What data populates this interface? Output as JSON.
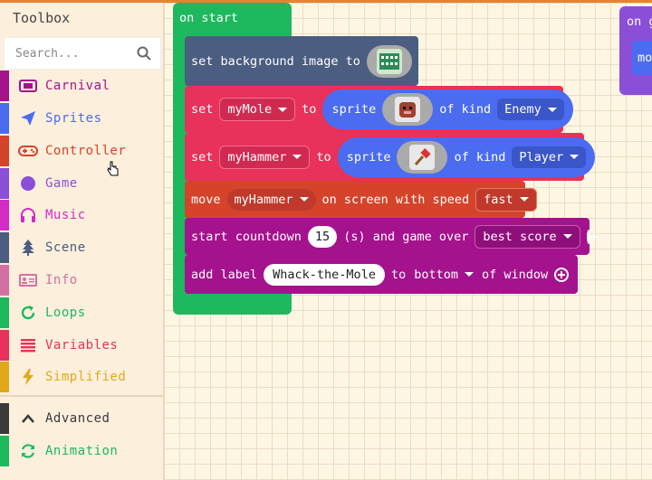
{
  "toolbox": {
    "title": "Toolbox",
    "search_placeholder": "Search...",
    "categories": [
      {
        "label": "Carnival",
        "color": "#a5128d",
        "text_color": "#a5128d",
        "icon": "ticket-icon"
      },
      {
        "label": "Sprites",
        "color": "#4b6cf0",
        "text_color": "#4b6cf0",
        "icon": "paper-plane-icon"
      },
      {
        "label": "Controller",
        "color": "#d5432b",
        "text_color": "#d5432b",
        "icon": "gamepad-icon"
      },
      {
        "label": "Game",
        "color": "#8a4fd6",
        "text_color": "#8a4fd6",
        "icon": "circle-icon"
      },
      {
        "label": "Music",
        "color": "#d22cc5",
        "text_color": "#d22cc5",
        "icon": "headphones-icon"
      },
      {
        "label": "Scene",
        "color": "#4b5d80",
        "text_color": "#4b5d80",
        "icon": "tree-icon"
      },
      {
        "label": "Info",
        "color": "#d36fa3",
        "text_color": "#d36fa3",
        "icon": "id-card-icon"
      },
      {
        "label": "Loops",
        "color": "#1eb85f",
        "text_color": "#1eb85f",
        "icon": "loop-icon"
      },
      {
        "label": "Variables",
        "color": "#e8315b",
        "text_color": "#e8315b",
        "icon": "list-icon"
      },
      {
        "label": "Simplified",
        "color": "#e0a91b",
        "text_color": "#e0a91b",
        "icon": "lightning-icon"
      },
      {
        "label": "Advanced",
        "color": "#3a3a3a",
        "text_color": "#3a3a3a",
        "icon": "chevron-up-icon"
      },
      {
        "label": "Animation",
        "color": "#1eb85f",
        "text_color": "#1eb85f",
        "icon": "refresh-icon"
      }
    ]
  },
  "workspace": {
    "on_start": "on start",
    "on_partial": "on g",
    "mo_partial": "mo",
    "bg_block": {
      "text": "set background image to",
      "icon": "background-image-icon"
    },
    "mole_block": {
      "set": "set",
      "var": "myMole",
      "to": "to",
      "sprite": "sprite",
      "of_kind": "of kind",
      "kind": "Enemy",
      "icon": "mole-sprite-icon"
    },
    "hammer_block": {
      "set": "set",
      "var": "myHammer",
      "to": "to",
      "sprite": "sprite",
      "of_kind": "of kind",
      "kind": "Player",
      "icon": "hammer-sprite-icon"
    },
    "move_block": {
      "move": "move",
      "var": "myHammer",
      "speed_text": "on screen with speed",
      "speed": "fast"
    },
    "countdown_block": {
      "start": "start countdown",
      "value": "15",
      "unit": "(s) and game over",
      "mode": "best score"
    },
    "label_block": {
      "add": "add label",
      "text": "Whack-the-Mole",
      "to": "to",
      "position": "bottom",
      "of": "of window"
    }
  }
}
